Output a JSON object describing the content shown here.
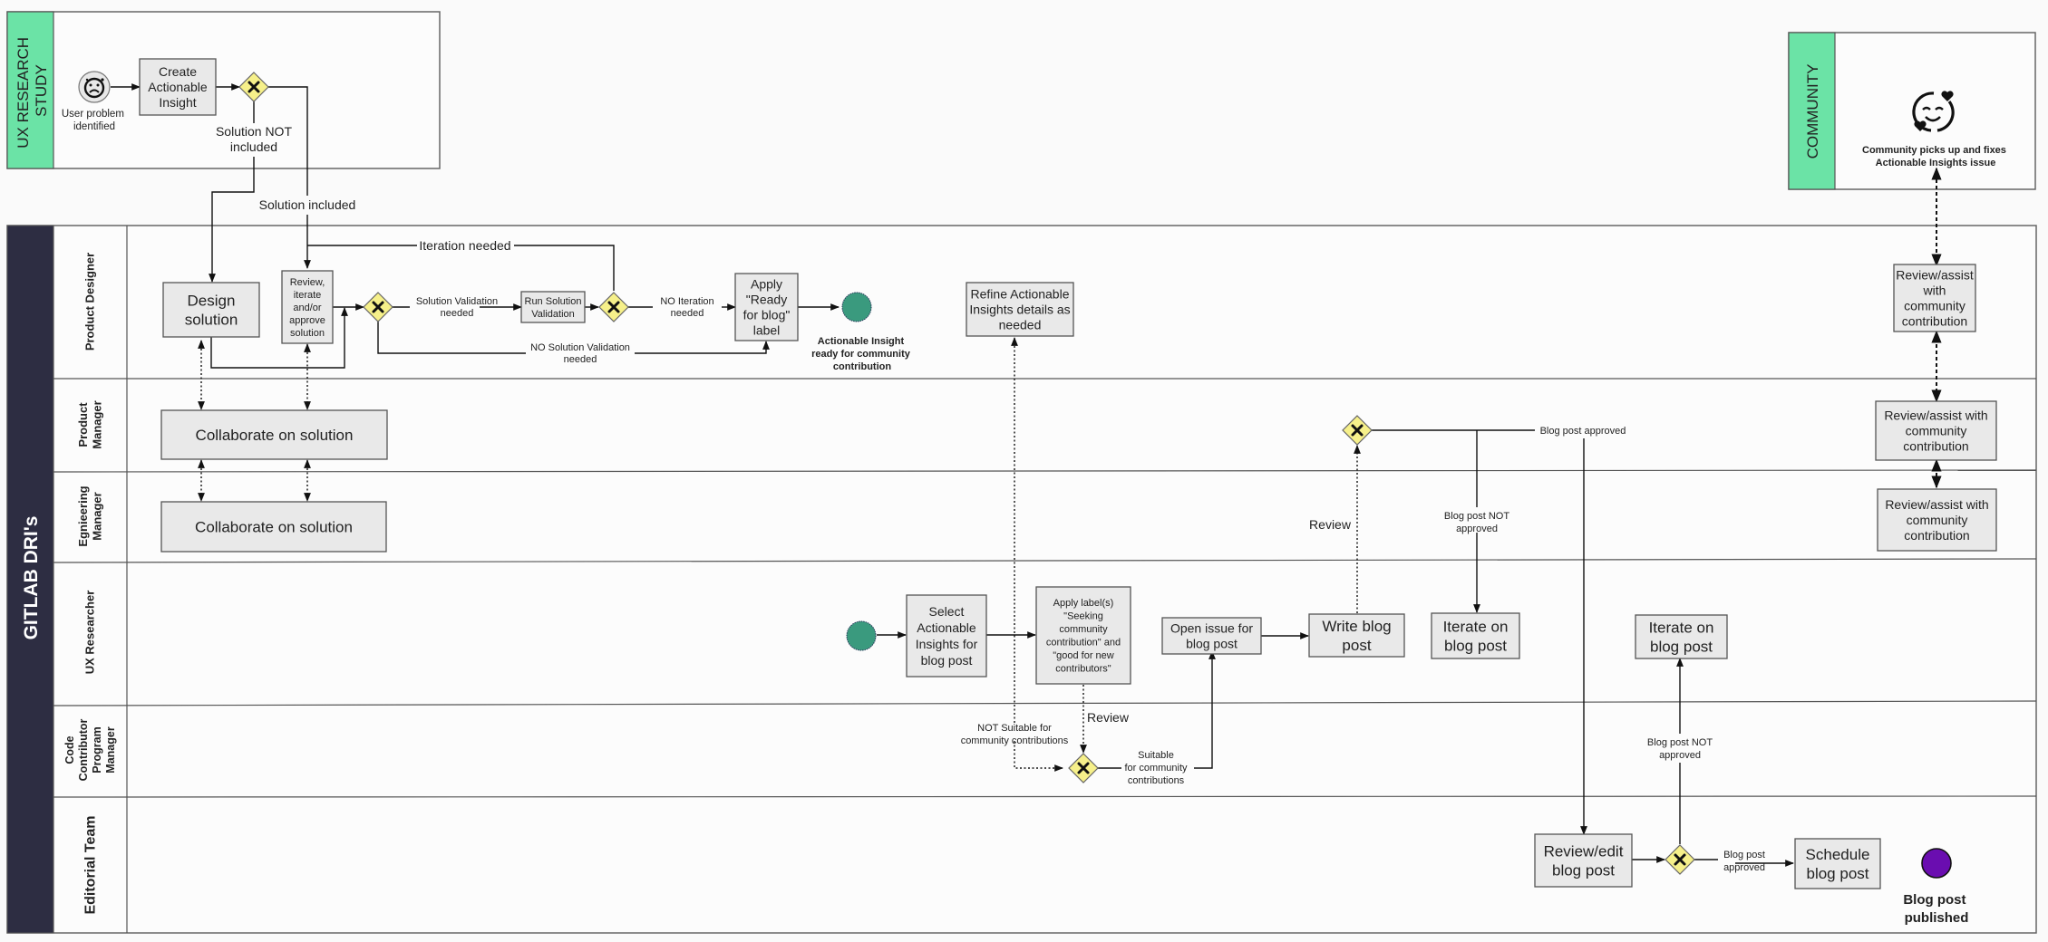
{
  "pools": {
    "ux_research_study": {
      "title": [
        "UX RESEARCH",
        "STUDY"
      ]
    },
    "community": {
      "title": "COMMUNITY",
      "event_label": [
        "Community picks up and fixes",
        "Actionable Insights issue"
      ]
    },
    "gitlab": {
      "title": "GITLAB DRI's"
    }
  },
  "lanes": [
    {
      "id": "product-designer",
      "label": [
        "Product Designer"
      ]
    },
    {
      "id": "product-manager",
      "label": [
        "Product",
        "Manager"
      ]
    },
    {
      "id": "engineering-manager",
      "label": [
        "Egnieering",
        "Manager"
      ]
    },
    {
      "id": "ux-researcher",
      "label": [
        "UX Researcher"
      ]
    },
    {
      "id": "code-contributor-program-manager",
      "label": [
        "Code",
        "Contributor",
        "Program",
        "Manager"
      ]
    },
    {
      "id": "editorial-team",
      "label": [
        "Editorial Team"
      ]
    }
  ],
  "events": {
    "user_problem": {
      "label": [
        "User problem",
        "identified"
      ]
    },
    "insight_ready": {
      "label": [
        "Actionable Insight",
        "ready for community",
        "contribution"
      ],
      "color": "#3a9a7e"
    },
    "uxr_start": {
      "color": "#3a9a7e"
    },
    "blog_published": {
      "label": [
        "Blog post",
        "published"
      ],
      "color": "#6a0db0"
    }
  },
  "tasks": {
    "create_insight": [
      "Create",
      "Actionable",
      "Insight"
    ],
    "design_solution": [
      "Design",
      "solution"
    ],
    "review_iterate": [
      "Review,",
      "iterate",
      "and/or",
      "approve",
      "solution"
    ],
    "run_validation": [
      "Run Solution",
      "Validation"
    ],
    "apply_ready_label": [
      "Apply",
      "\"Ready",
      "for blog\"",
      "label"
    ],
    "refine_insights": [
      "Refine Actionable",
      "Insights details as",
      "needed"
    ],
    "pm_collaborate": [
      "Collaborate on solution"
    ],
    "em_collaborate": [
      "Collaborate on solution"
    ],
    "select_insights": [
      "Select",
      "Actionable",
      "Insights for",
      "blog post"
    ],
    "apply_labels": [
      "Apply label(s)",
      "\"Seeking",
      "community",
      "contribution\" and",
      "\"good for new",
      "contributors\""
    ],
    "open_issue": [
      "Open issue for",
      "blog post"
    ],
    "write_blog": [
      "Write blog",
      "post"
    ],
    "iterate_blog_1": [
      "Iterate on",
      "blog post"
    ],
    "iterate_blog_2": [
      "Iterate on",
      "blog post"
    ],
    "review_edit_blog": [
      "Review/edit",
      "blog post"
    ],
    "schedule_blog": [
      "Schedule",
      "blog post"
    ],
    "pd_review_assist": [
      "Review/assist",
      "with",
      "community",
      "contribution"
    ],
    "pm_review_assist": [
      "Review/assist with",
      "community",
      "contribution"
    ],
    "em_review_assist": [
      "Review/assist with",
      "community",
      "contribution"
    ]
  },
  "flow_labels": {
    "solution_not_included": [
      "Solution NOT",
      "included"
    ],
    "solution_included": [
      "Solution included"
    ],
    "iteration_needed": [
      "Iteration needed"
    ],
    "solution_validation_needed": [
      "Solution Validation",
      "needed"
    ],
    "no_iteration_needed": [
      "NO Iteration",
      "needed"
    ],
    "no_solution_validation_needed": [
      "NO Solution Validation",
      "needed"
    ],
    "review_cc": [
      "Review"
    ],
    "not_suitable": [
      "NOT Suitable for",
      "community contributions"
    ],
    "suitable": [
      "Suitable",
      "for community",
      "contributions"
    ],
    "review_pm": [
      "Review"
    ],
    "blog_approved_pm": [
      "Blog post approved"
    ],
    "blog_not_approved_pm": [
      "Blog post NOT",
      "approved"
    ],
    "blog_not_approved_ed": [
      "Blog post NOT",
      "approved"
    ],
    "blog_approved_ed": [
      "Blog post",
      "approved"
    ]
  },
  "icons": {
    "user_problem": "sad-face-icon",
    "community": "smiling-face-with-hearts-icon",
    "gateway": "exclusive-gateway-x-icon"
  }
}
